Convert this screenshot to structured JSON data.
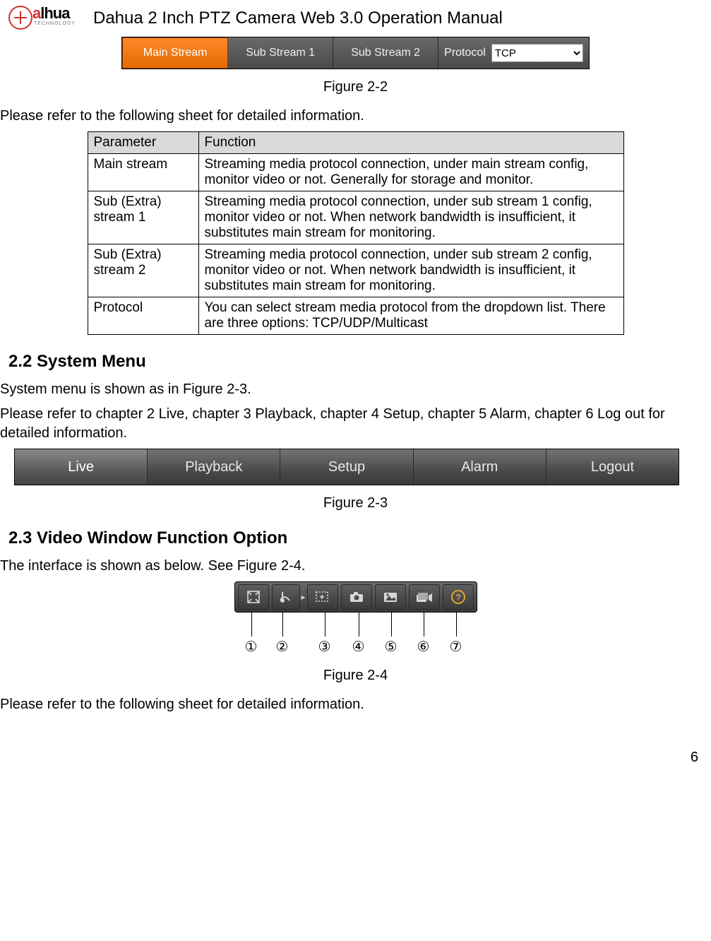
{
  "logo": {
    "brand_a": "a",
    "brand_rest": "lhua",
    "sub": "TECHNOLOGY"
  },
  "doc_title": "Dahua 2 Inch PTZ Camera Web 3.0 Operation Manual",
  "fig22": {
    "tabs": [
      "Main Stream",
      "Sub Stream 1",
      "Sub Stream 2"
    ],
    "protocol_label": "Protocol",
    "protocol_value": "TCP"
  },
  "figcap22": "Figure 2-2",
  "intro_text1": "Please refer to the following sheet for detailed information.",
  "table_headers": {
    "p": "Parameter",
    "f": "Function"
  },
  "table_rows": [
    {
      "p": "Main stream",
      "f": "Streaming media protocol connection, under main stream config, monitor video or not. Generally for storage and monitor."
    },
    {
      "p": "Sub (Extra) stream 1",
      "f": "Streaming media protocol connection, under sub stream 1 config, monitor video or not. When network bandwidth is insufficient, it substitutes main stream for monitoring."
    },
    {
      "p": "Sub (Extra) stream 2",
      "f": "Streaming media protocol connection, under sub stream 2 config, monitor video or not. When network bandwidth is insufficient, it substitutes main stream for monitoring."
    },
    {
      "p": "Protocol",
      "f": "You can select stream media protocol from the dropdown list. There are three options: TCP/UDP/Multicast"
    }
  ],
  "sec22": "2.2  System Menu",
  "sec22_p1": "System menu is shown as in Figure 2-3.",
  "sec22_p2": "Please refer to chapter 2 Live, chapter 3 Playback, chapter 4 Setup, chapter 5 Alarm, chapter 6 Log out for detailed information.",
  "fig23": {
    "tabs": [
      "Live",
      "Playback",
      "Setup",
      "Alarm",
      "Logout"
    ]
  },
  "figcap23": "Figure 2-3",
  "sec23": "2.3  Video Window Function Option",
  "sec23_p1": "The interface is shown as below. See Figure 2-4.",
  "fig24": {
    "icons": [
      "fullscreen-icon",
      "adjust-icon",
      "zoom-icon",
      "snapshot-icon",
      "picture-icon",
      "record-icon",
      "help-icon"
    ],
    "numbers": [
      "①",
      "②",
      "③",
      "④",
      "⑤",
      "⑥",
      "⑦"
    ]
  },
  "figcap24": "Figure 2-4",
  "outro_text": "Please refer to the following sheet for detailed information.",
  "page_number": "6"
}
